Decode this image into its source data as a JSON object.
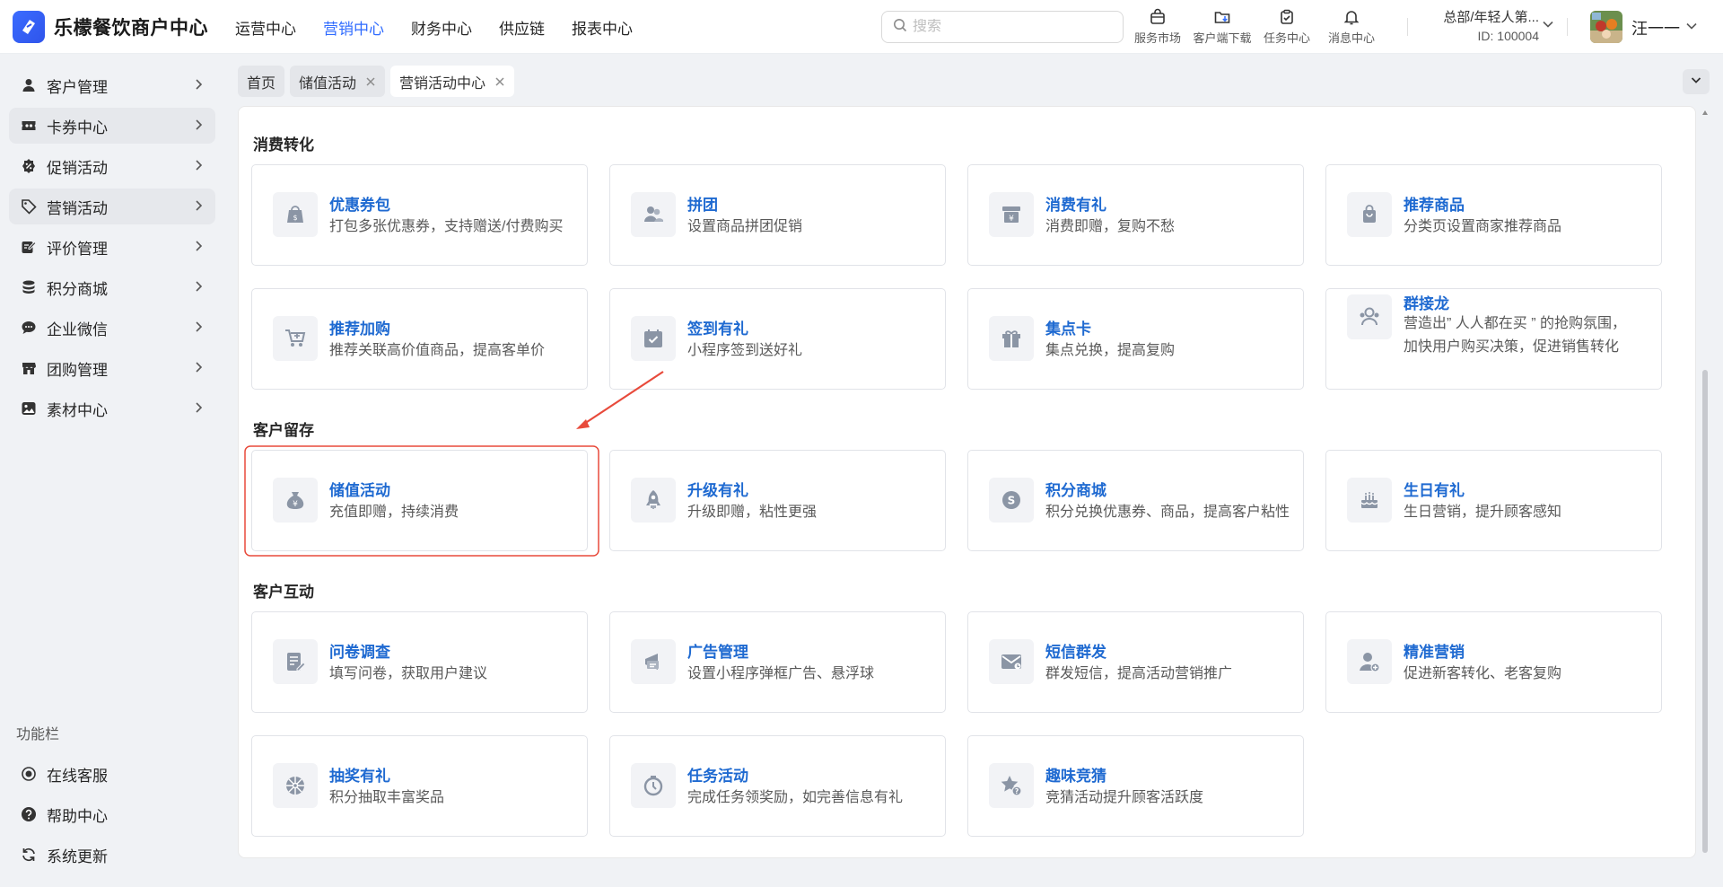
{
  "brand": {
    "name": "乐檬餐饮商户中心"
  },
  "topnav": [
    "运营中心",
    "营销中心",
    "财务中心",
    "供应链",
    "报表中心"
  ],
  "search": {
    "placeholder": "搜索"
  },
  "tools": [
    "服务市场",
    "客户端下载",
    "任务中心",
    "消息中心"
  ],
  "account": {
    "name": "总部/年轻人第...",
    "id": "ID: 100004"
  },
  "user": {
    "name": "汪一一"
  },
  "sidebar": {
    "items": [
      "客户管理",
      "卡券中心",
      "促销活动",
      "营销活动",
      "评价管理",
      "积分商城",
      "企业微信",
      "团购管理",
      "素材中心"
    ],
    "func_title": "功能栏",
    "func_items": [
      "在线客服",
      "帮助中心",
      "系统更新"
    ]
  },
  "tabs": [
    "首页",
    "储值活动",
    "营销活动中心"
  ],
  "sections": [
    {
      "title": "消费转化",
      "cards": [
        {
          "title": "优惠券包",
          "desc": "打包多张优惠券，支持赠送/付费购买",
          "icon": "bag-coupon-icon"
        },
        {
          "title": "拼团",
          "desc": "设置商品拼团促销",
          "icon": "group-users-icon"
        },
        {
          "title": "消费有礼",
          "desc": "消费即赠，复购不愁",
          "icon": "yen-box-icon"
        },
        {
          "title": "推荐商品",
          "desc": "分类页设置商家推荐商品",
          "icon": "shopping-bag-icon"
        },
        {
          "title": "推荐加购",
          "desc": "推荐关联高价值商品，提高客单价",
          "icon": "cart-plus-icon"
        },
        {
          "title": "签到有礼",
          "desc": "小程序签到送好礼",
          "icon": "calendar-check-icon"
        },
        {
          "title": "集点卡",
          "desc": "集点兑换，提高复购",
          "icon": "gift-icon"
        },
        {
          "title": "群接龙",
          "desc": "营造出” 人人都在买 ” 的抢购氛围，\n加快用户购买决策，促进销售转化",
          "icon": "users-group-icon"
        }
      ]
    },
    {
      "title": "客户留存",
      "cards": [
        {
          "title": "储值活动",
          "desc": "充值即赠，持续消费",
          "icon": "money-bag-icon"
        },
        {
          "title": "升级有礼",
          "desc": "升级即赠，粘性更强",
          "icon": "rocket-icon"
        },
        {
          "title": "积分商城",
          "desc": "积分兑换优惠券、商品，提高客户粘性",
          "icon": "coin-icon"
        },
        {
          "title": "生日有礼",
          "desc": "生日营销，提升顾客感知",
          "icon": "birthday-cake-icon"
        }
      ]
    },
    {
      "title": "客户互动",
      "cards": [
        {
          "title": "问卷调查",
          "desc": "填写问卷，获取用户建议",
          "icon": "survey-icon"
        },
        {
          "title": "广告管理",
          "desc": "设置小程序弹框广告、悬浮球",
          "icon": "ad-icon"
        },
        {
          "title": "短信群发",
          "desc": "群发短信，提高活动营销推广",
          "icon": "mail-icon"
        },
        {
          "title": "精准营销",
          "desc": "促进新客转化、老客复购",
          "icon": "user-target-icon"
        },
        {
          "title": "抽奖有礼",
          "desc": "积分抽取丰富奖品",
          "icon": "lottery-wheel-icon"
        },
        {
          "title": "任务活动",
          "desc": "完成任务领奖励，如完善信息有礼",
          "icon": "timer-icon"
        },
        {
          "title": "趣味竞猜",
          "desc": "竞猜活动提升顾客活跃度",
          "icon": "star-question-icon"
        }
      ]
    }
  ],
  "colors": {
    "accent": "#2f6bff",
    "link": "#1f6ad1",
    "highlight": "#e84a3b"
  }
}
